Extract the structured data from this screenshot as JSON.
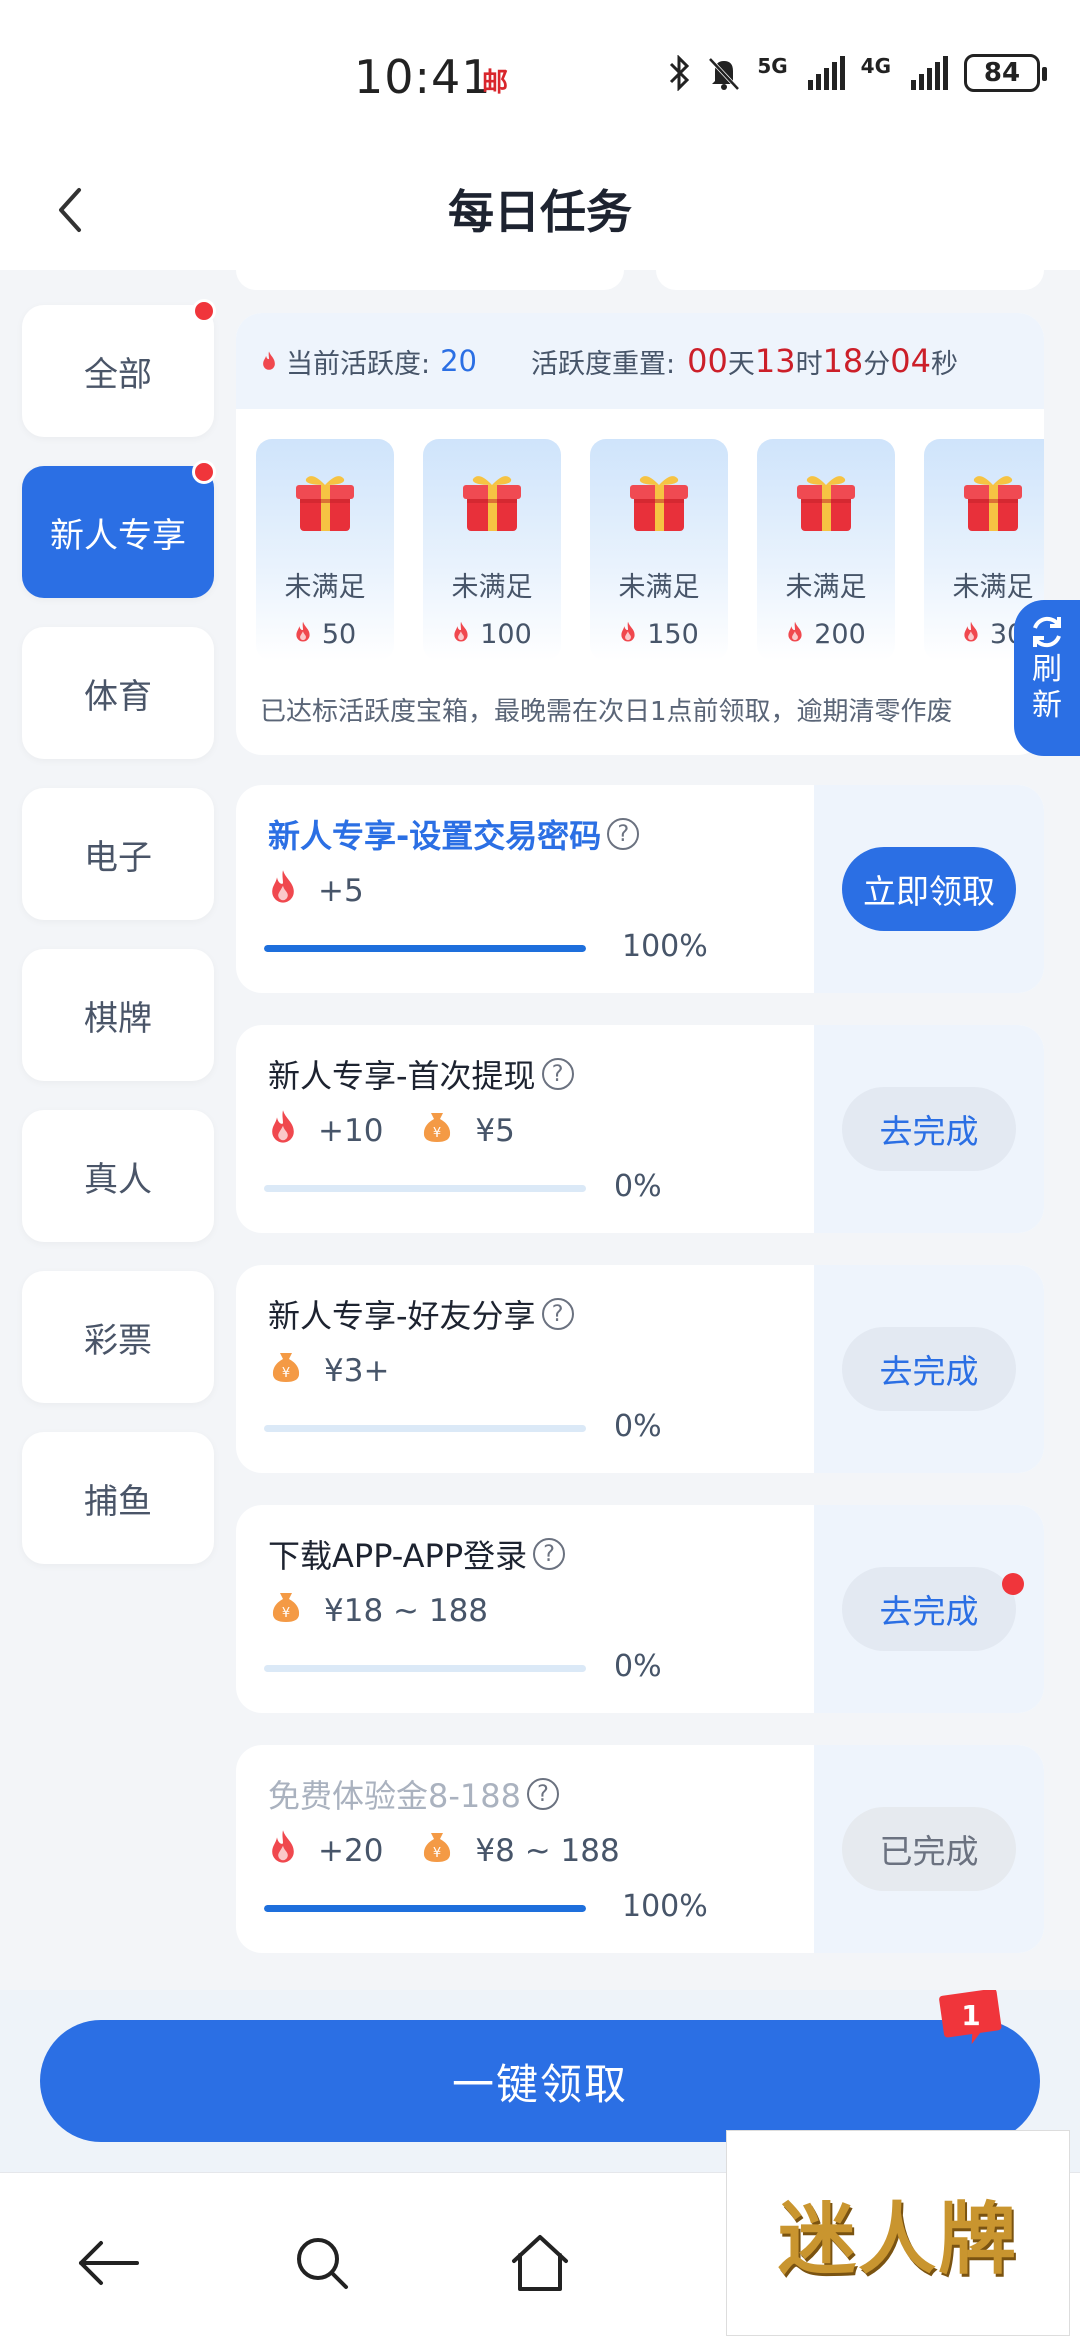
{
  "status_bar": {
    "time": "10:41",
    "carrier_icon": "邮",
    "net1": "5G",
    "net2": "4G",
    "battery": "84"
  },
  "header": {
    "title": "每日任务"
  },
  "sidebar": {
    "items": [
      {
        "label": "全部",
        "dot": true,
        "active": false
      },
      {
        "label": "新人专享",
        "dot": true,
        "active": true
      },
      {
        "label": "体育",
        "dot": false,
        "active": false
      },
      {
        "label": "电子",
        "dot": false,
        "active": false
      },
      {
        "label": "棋牌",
        "dot": false,
        "active": false
      },
      {
        "label": "真人",
        "dot": false,
        "active": false
      },
      {
        "label": "彩票",
        "dot": false,
        "active": false
      },
      {
        "label": "捕鱼",
        "dot": false,
        "active": false
      }
    ]
  },
  "activity": {
    "current_label": "当前活跃度:",
    "current_value": "20",
    "reset_label": "活跃度重置:",
    "days": "00",
    "days_unit": "天",
    "hours": "13",
    "hours_unit": "时",
    "minutes": "18",
    "minutes_unit": "分",
    "seconds": "04",
    "seconds_unit": "秒",
    "gifts": [
      {
        "status": "未满足",
        "points": "50"
      },
      {
        "status": "未满足",
        "points": "100"
      },
      {
        "status": "未满足",
        "points": "150"
      },
      {
        "status": "未满足",
        "points": "200"
      },
      {
        "status": "未满足",
        "points": "30"
      }
    ],
    "note": "已达标活跃度宝箱，最晚需在次日1点前领取，逾期清零作废"
  },
  "refresh": {
    "line1": "刷",
    "line2": "新"
  },
  "tasks": [
    {
      "name": "新人专享-设置交易密码",
      "flame": "+5",
      "money": "",
      "progress": 1.0,
      "pct": "100%",
      "button": "立即领取"
    },
    {
      "name": "新人专享-首次提现",
      "flame": "+10",
      "money": "¥5",
      "progress": 0.0,
      "pct": "0%",
      "button": "去完成"
    },
    {
      "name": "新人专享-好友分享",
      "flame": "",
      "money": "¥3+",
      "progress": 0.0,
      "pct": "0%",
      "button": "去完成"
    },
    {
      "name": "下载APP-APP登录",
      "flame": "",
      "money": "¥18 ~ 188",
      "progress": 0.0,
      "pct": "0%",
      "button": "去完成"
    },
    {
      "name": "免费体验金8-188",
      "flame": "+20",
      "money": "¥8 ~ 188",
      "progress": 1.0,
      "pct": "100%",
      "button": "已完成"
    }
  ],
  "question_mark": "?",
  "claim_all": {
    "label": "一键领取",
    "badge": "1"
  },
  "watermark": "迷人牌",
  "colors": {
    "accent": "#2b6fe4",
    "red": "#cc1f29",
    "dot": "#f0353b",
    "panel": "#eef4fc"
  }
}
